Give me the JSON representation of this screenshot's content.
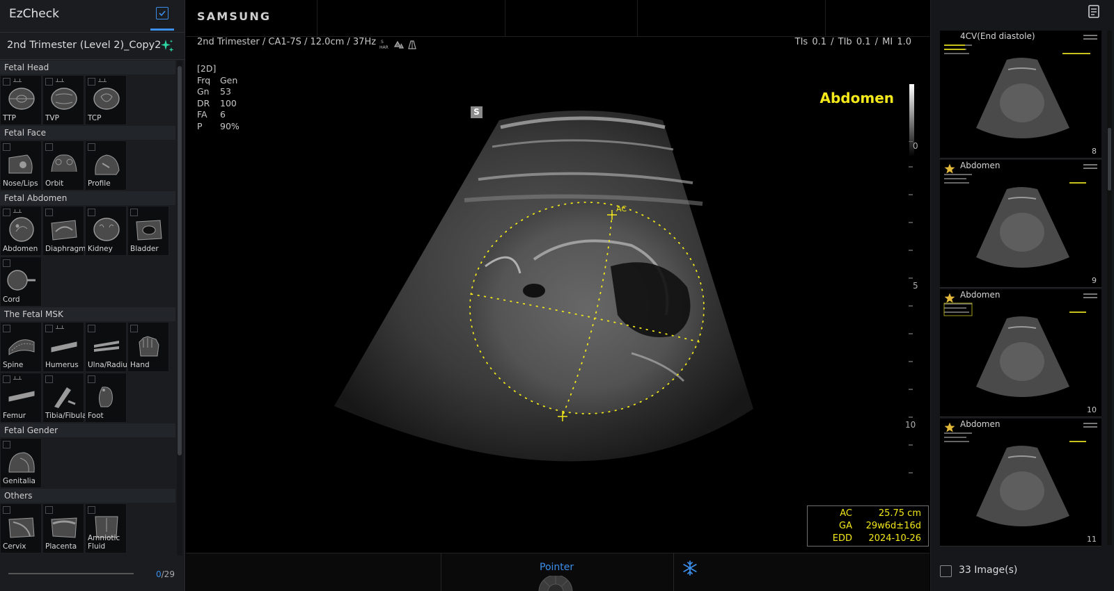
{
  "sidebar": {
    "title": "EzCheck",
    "preset": "2nd Trimester (Level 2)_Copy2",
    "sections": [
      {
        "label": "Fetal Head",
        "items": [
          {
            "label": "TTP",
            "ruler": true,
            "icon": "head-ttp-icon"
          },
          {
            "label": "TVP",
            "ruler": true,
            "icon": "head-tvp-icon"
          },
          {
            "label": "TCP",
            "ruler": true,
            "icon": "head-tcp-icon"
          }
        ]
      },
      {
        "label": "Fetal Face",
        "items": [
          {
            "label": "Nose/Lips",
            "ruler": false,
            "icon": "nose-lips-icon"
          },
          {
            "label": "Orbit",
            "ruler": false,
            "icon": "orbit-icon"
          },
          {
            "label": "Profile",
            "ruler": false,
            "icon": "profile-icon"
          }
        ]
      },
      {
        "label": "Fetal Abdomen",
        "items": [
          {
            "label": "Abdomen",
            "ruler": true,
            "icon": "abdomen-icon"
          },
          {
            "label": "Diaphragm",
            "ruler": false,
            "icon": "diaphragm-icon"
          },
          {
            "label": "Kidney",
            "ruler": false,
            "icon": "kidney-icon"
          },
          {
            "label": "Bladder",
            "ruler": false,
            "icon": "bladder-icon"
          },
          {
            "label": "Cord",
            "ruler": false,
            "icon": "cord-icon"
          }
        ]
      },
      {
        "label": "The Fetal MSK",
        "items": [
          {
            "label": "Spine",
            "ruler": false,
            "icon": "spine-icon"
          },
          {
            "label": "Humerus",
            "ruler": true,
            "icon": "humerus-icon"
          },
          {
            "label": "Ulna/Radius",
            "ruler": false,
            "icon": "ulna-radius-icon"
          },
          {
            "label": "Hand",
            "ruler": false,
            "icon": "hand-icon"
          },
          {
            "label": "Femur",
            "ruler": true,
            "icon": "femur-icon"
          },
          {
            "label": "Tibia/Fibula",
            "ruler": false,
            "icon": "tibia-fibula-icon"
          },
          {
            "label": "Foot",
            "ruler": false,
            "icon": "foot-icon"
          }
        ]
      },
      {
        "label": "Fetal Gender",
        "items": [
          {
            "label": "Genitalia",
            "ruler": false,
            "icon": "genitalia-icon"
          }
        ]
      },
      {
        "label": "Others",
        "items": [
          {
            "label": "Cervix",
            "ruler": false,
            "icon": "cervix-icon"
          },
          {
            "label": "Placenta",
            "ruler": false,
            "icon": "placenta-icon"
          },
          {
            "label": "Amniotic Fluid",
            "ruler": false,
            "icon": "amniotic-fluid-icon"
          }
        ]
      }
    ],
    "progress_done": "0",
    "progress_total": "/29"
  },
  "topbar": {
    "brand": "SAMSUNG"
  },
  "image": {
    "probe_info": "2nd Trimester / CA1-7S / 12.0cm / 37Hz",
    "har_top": "S",
    "har_bottom": "HAR",
    "index_info": "TIs  0.1 / TIb  0.1 / MI     1.0",
    "params": [
      {
        "k": "Frq",
        "v": "Gen"
      },
      {
        "k": "Gn",
        "v": "53"
      },
      {
        "k": "DR",
        "v": "100"
      },
      {
        "k": "FA",
        "v": "6"
      },
      {
        "k": "P",
        "v": "90%"
      }
    ],
    "mode": "[2D]",
    "orientation_marker": "S",
    "body_mark": "Abdomen",
    "depth_labels": {
      "zero": "0",
      "five": "5",
      "ten": "10"
    },
    "caliper_label": "AC",
    "caliper_color": "#f2e81a",
    "measurements": [
      {
        "k": "AC",
        "v": "25.75  cm"
      },
      {
        "k": "GA",
        "v": "29w6d±16d"
      },
      {
        "k": "EDD",
        "v": "2024-10-26"
      }
    ]
  },
  "bottombar": {
    "pointer_label": "Pointer",
    "freeze_icon": "snowflake-icon"
  },
  "thumbnails": [
    {
      "title": "4CV(End diastole)",
      "number": "8",
      "starred": false
    },
    {
      "title": "Abdomen",
      "number": "9",
      "starred": true
    },
    {
      "title": "Abdomen",
      "number": "10",
      "starred": true
    },
    {
      "title": "Abdomen",
      "number": "11",
      "starred": true
    }
  ],
  "right_footer": {
    "count_label": "33 Image(s)"
  },
  "colors": {
    "accent": "#3b8eea",
    "measure": "#f2e81a",
    "sparkle": "#2fd6a3",
    "star": "#e3b93c"
  }
}
